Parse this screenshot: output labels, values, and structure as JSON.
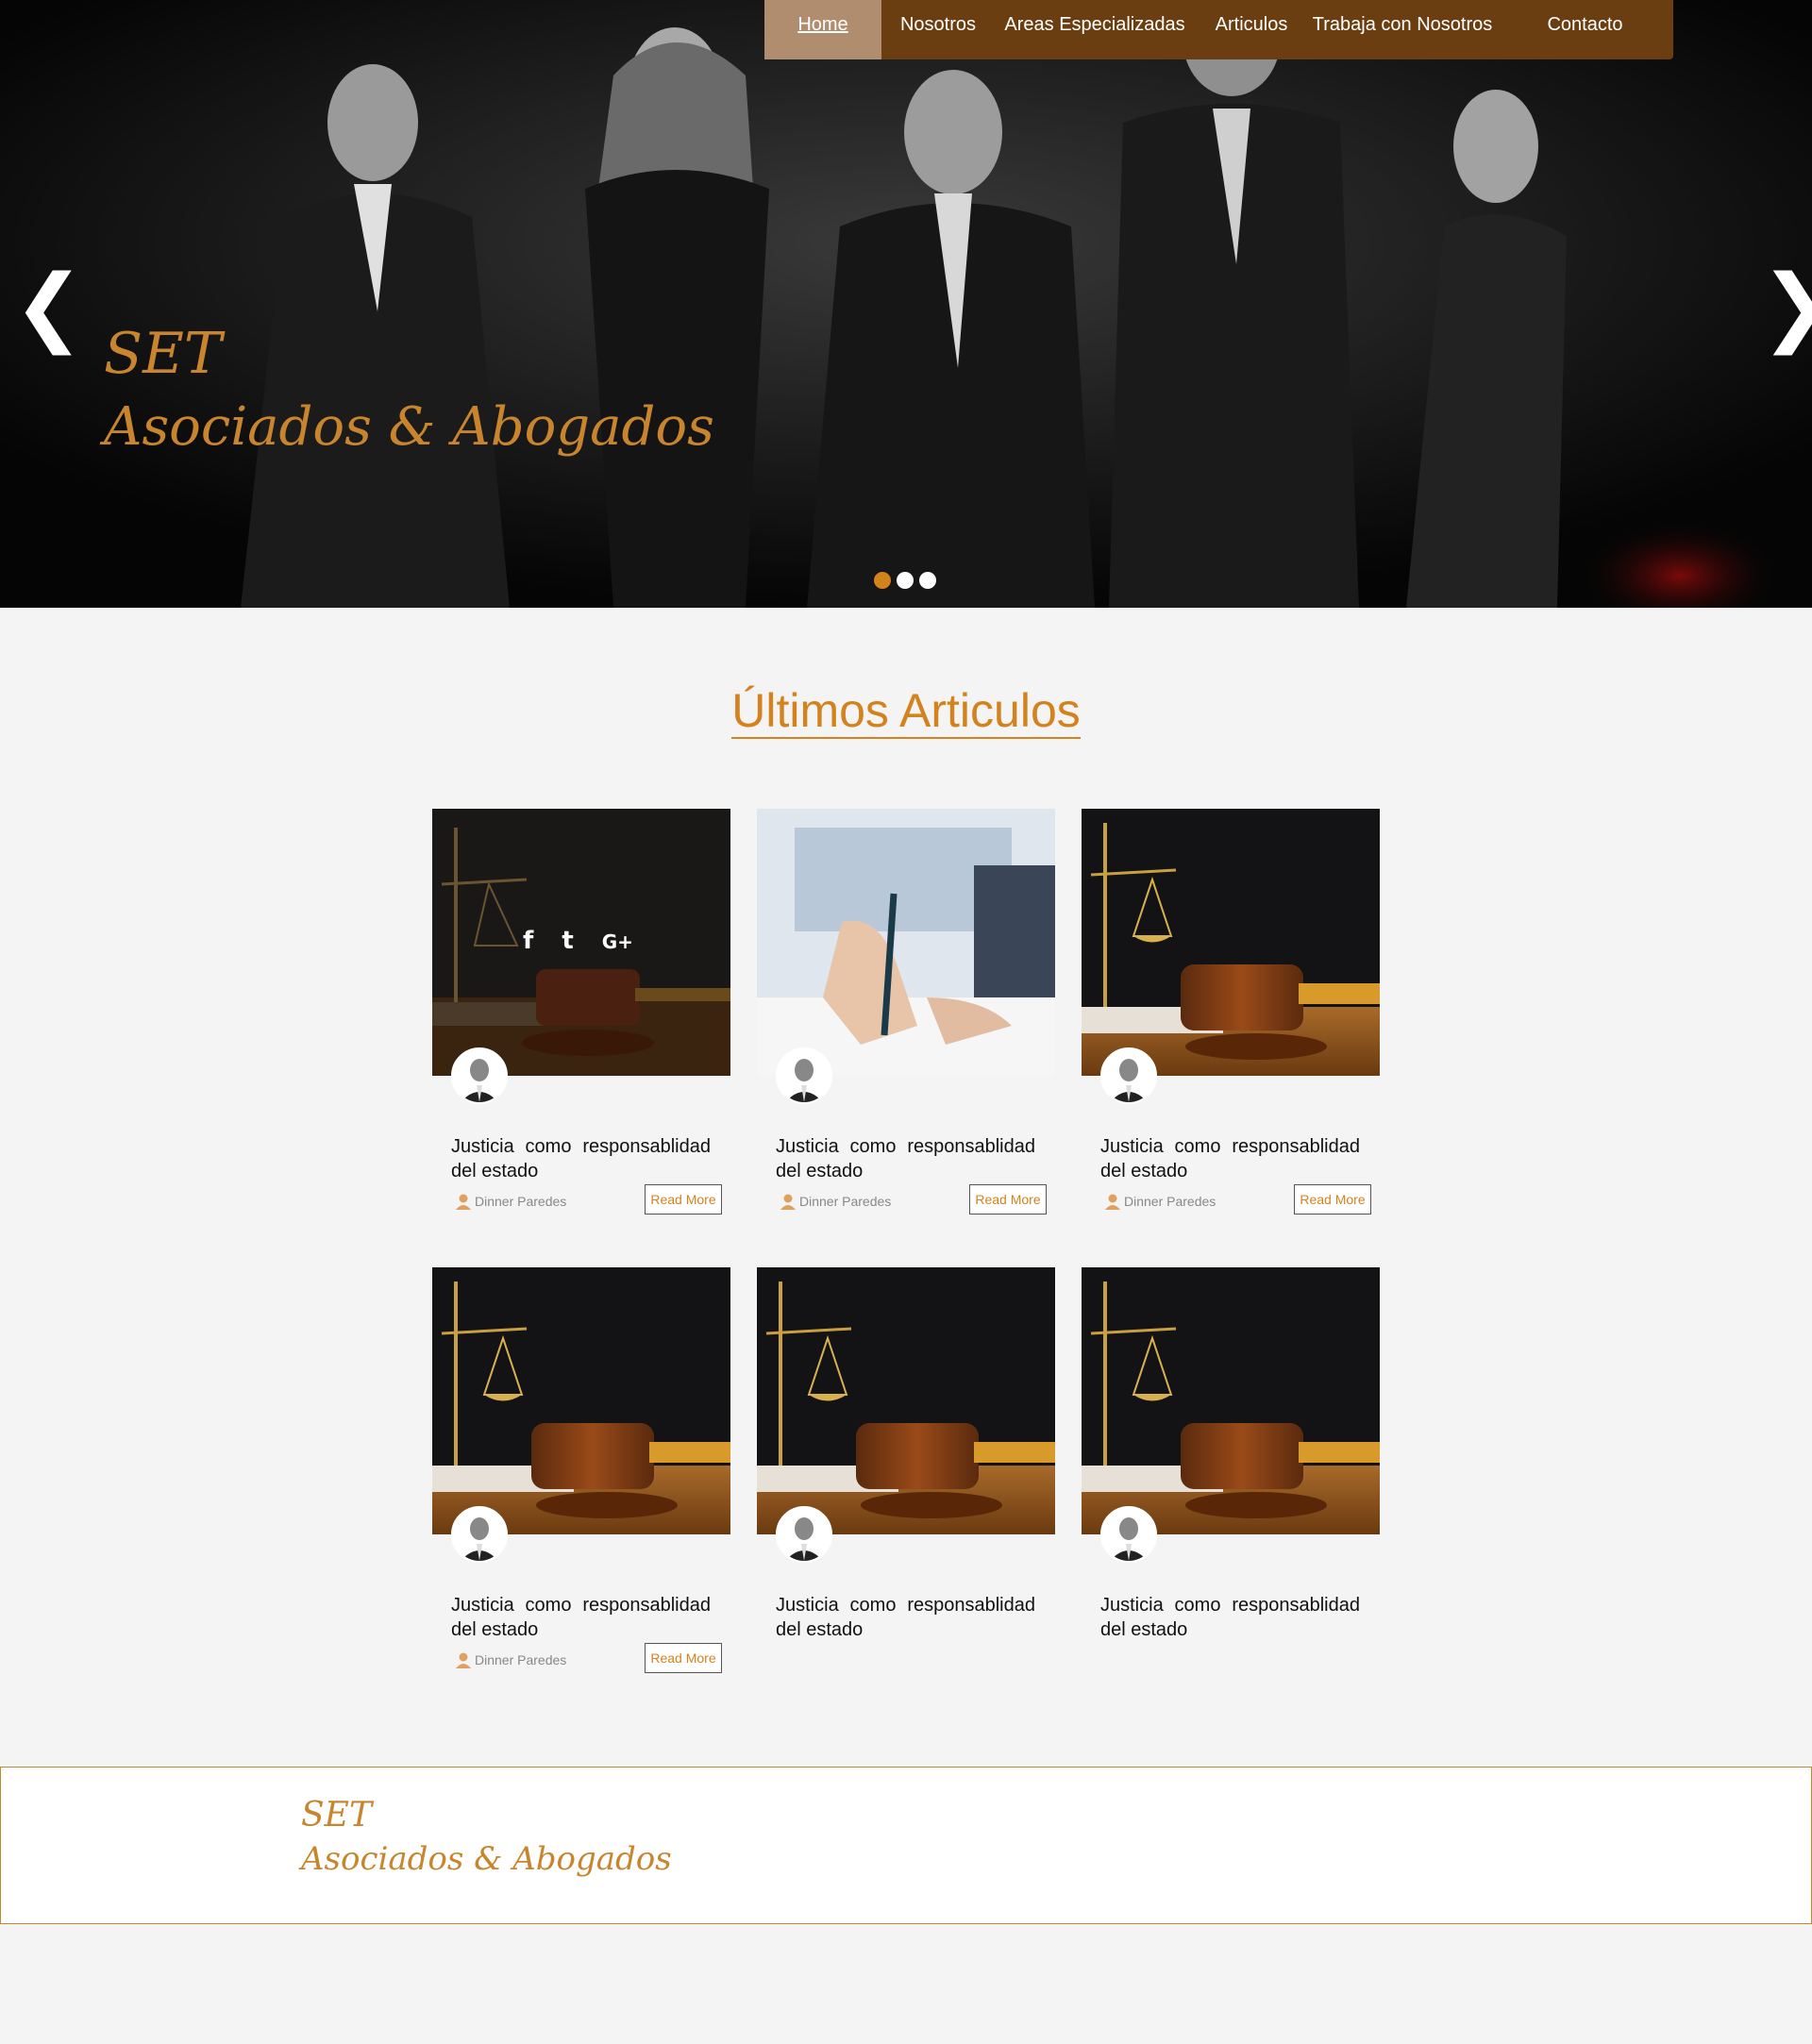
{
  "nav": {
    "items": [
      {
        "label": "Home"
      },
      {
        "label": "Nosotros"
      },
      {
        "label": "Areas Especializadas"
      },
      {
        "label": "Articulos"
      },
      {
        "label": "Trabaja con Nosotros"
      },
      {
        "label": "Contacto"
      }
    ],
    "active": "Home"
  },
  "hero": {
    "brand_line1": "SET",
    "brand_line2": "Asociados & Abogados",
    "prev_arrow": "❮",
    "next_arrow": "❯",
    "slides": 3,
    "active_slide": 1
  },
  "articles": {
    "section_title": "Últimos Articulos",
    "cards": [
      {
        "title": "Justicia como responsablidad del estado",
        "author": "Dinner Paredes",
        "read_more": "Read More",
        "image": "gavel-dark-hover",
        "social": [
          "f",
          "t",
          "G+"
        ]
      },
      {
        "title": "Justicia como responsablidad del estado",
        "author": "Dinner Paredes",
        "read_more": "Read More",
        "image": "signing-document"
      },
      {
        "title": "Justicia como responsablidad del estado",
        "author": "Dinner Paredes",
        "read_more": "Read More",
        "image": "gavel-scales"
      },
      {
        "title": "Justicia como responsablidad del estado",
        "author": "Dinner Paredes",
        "read_more": "Read More",
        "image": "gavel-scales"
      },
      {
        "title": "Justicia como responsablidad del estado",
        "image": "gavel-scales"
      },
      {
        "title": "Justicia como responsablidad del estado",
        "image": "gavel-scales"
      }
    ]
  },
  "footer": {
    "brand_line1": "SET",
    "brand_line2": "Asociados & Abogados"
  },
  "colors": {
    "accent": "#d4821e",
    "nav_bg": "#6b3e12",
    "nav_active": "#b08d6e"
  }
}
